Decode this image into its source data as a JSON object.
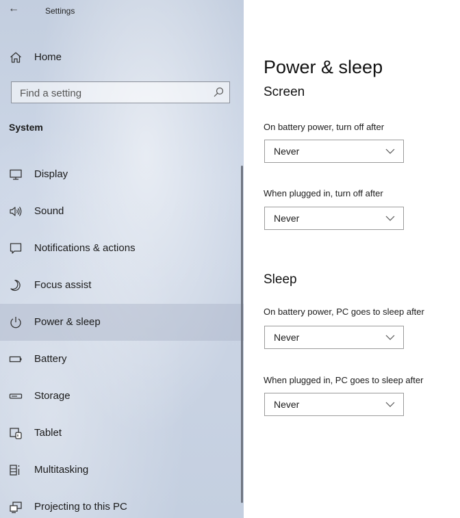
{
  "window": {
    "title": "Settings",
    "back_icon": "←"
  },
  "sidebar": {
    "home_label": "Home",
    "search": {
      "placeholder": "Find a setting"
    },
    "section_title": "System",
    "items": [
      {
        "label": "Display",
        "icon": "display-icon"
      },
      {
        "label": "Sound",
        "icon": "sound-icon"
      },
      {
        "label": "Notifications & actions",
        "icon": "notifications-icon"
      },
      {
        "label": "Focus assist",
        "icon": "focus-assist-icon"
      },
      {
        "label": "Power & sleep",
        "icon": "power-icon",
        "selected": true
      },
      {
        "label": "Battery",
        "icon": "battery-icon"
      },
      {
        "label": "Storage",
        "icon": "storage-icon"
      },
      {
        "label": "Tablet",
        "icon": "tablet-icon"
      },
      {
        "label": "Multitasking",
        "icon": "multitasking-icon"
      },
      {
        "label": "Projecting to this PC",
        "icon": "projecting-icon"
      }
    ]
  },
  "main": {
    "title": "Power & sleep",
    "screen": {
      "heading": "Screen",
      "battery_label": "On battery power, turn off after",
      "battery_value": "Never",
      "plugged_label": "When plugged in, turn off after",
      "plugged_value": "Never"
    },
    "sleep": {
      "heading": "Sleep",
      "battery_label": "On battery power, PC goes to sleep after",
      "battery_value": "Never",
      "plugged_label": "When plugged in, PC goes to sleep after",
      "plugged_value": "Never"
    }
  },
  "colors": {
    "sidebar_bg": "#c9d3e3",
    "selected_bg": "#b4bccb",
    "text": "#1a1a1a"
  }
}
